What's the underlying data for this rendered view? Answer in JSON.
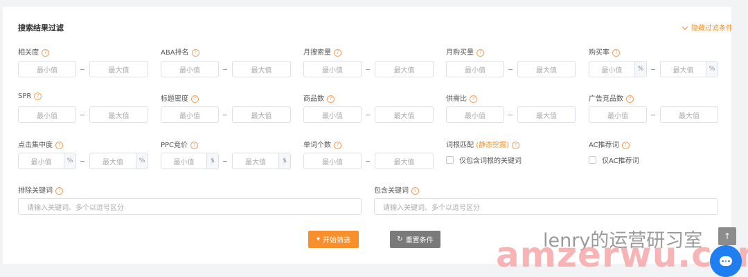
{
  "header": {
    "title": "搜索结果过滤",
    "hide_filters": "隐藏过滤条件"
  },
  "placeholders": {
    "min": "最小值",
    "max": "最大值",
    "keyword": "请输入关键词、多个以逗号区分"
  },
  "units": {
    "percent": "%",
    "dollar": "$"
  },
  "help_mark": "?",
  "filters": {
    "relevance": "相关度",
    "aba_rank": "ABA排名",
    "monthly_search": "月搜索量",
    "monthly_purchase": "月购买量",
    "purchase_rate": "购买率",
    "spr": "SPR",
    "title_density": "标题密度",
    "product_count": "商品数",
    "supply_demand": "供需比",
    "ad_product_count": "广告竞品数",
    "click_concentration": "点击集中度",
    "ppc_bid": "PPC竞价",
    "word_count": "单词个数",
    "root_match": "词根匹配",
    "root_match_highlight": "(静态挖掘)",
    "root_only": "仅包含词根的关键词",
    "ac_keyword": "AC推荐词",
    "ac_only": "仅AC推荐词",
    "exclude_keywords": "排除关键词",
    "include_keywords": "包含关键词"
  },
  "buttons": {
    "start": "开始筛选",
    "reset": "重置条件"
  },
  "watermark": {
    "top": "lenry的运营研习室",
    "bottom": "amzerwu.com"
  },
  "colors": {
    "accent": "#f7902a",
    "reset": "#7a7a7a",
    "chat": "#1f7ff0"
  }
}
